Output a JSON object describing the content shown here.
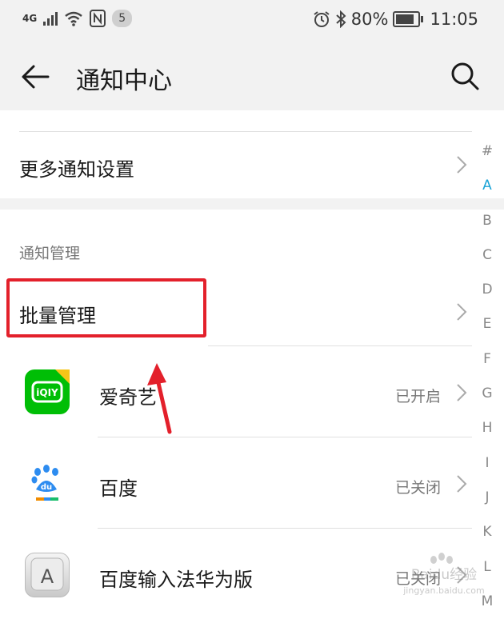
{
  "status_bar": {
    "network": "4G",
    "notif_count": "5",
    "battery": "80%",
    "time": "11:05"
  },
  "header": {
    "title": "通知中心"
  },
  "settings_row": {
    "label": "更多通知设置"
  },
  "section": {
    "subtitle": "通知管理"
  },
  "batch_row": {
    "label": "批量管理"
  },
  "apps": [
    {
      "name": "爱奇艺",
      "status": "已开启",
      "icon": "iqiyi-icon"
    },
    {
      "name": "百度",
      "status": "已关闭",
      "icon": "baidu-icon"
    },
    {
      "name": "百度输入法华为版",
      "status": "已关闭",
      "icon": "baidu-input-icon"
    }
  ],
  "az_index": [
    "#",
    "A",
    "B",
    "C",
    "D",
    "E",
    "F",
    "G",
    "H",
    "I",
    "J",
    "K",
    "L",
    "M"
  ],
  "az_active": "A",
  "watermark": {
    "text": "Baidu经验",
    "url_text": "jingyan.baidu.com"
  },
  "colors": {
    "accent": "#1aa3d6",
    "highlight": "#e3202b",
    "iqiyi": "#00be06"
  }
}
